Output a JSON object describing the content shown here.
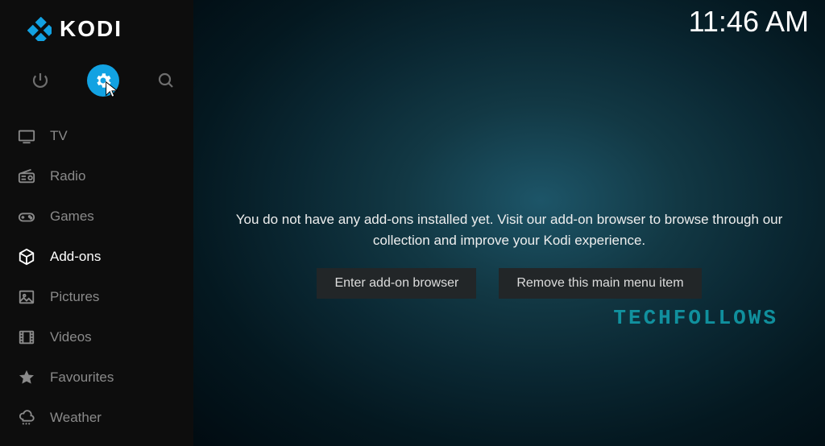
{
  "app": {
    "name": "KODI"
  },
  "clock": "11:46 AM",
  "sidebar": {
    "items": [
      {
        "label": "TV",
        "icon": "tv-icon",
        "selected": false
      },
      {
        "label": "Radio",
        "icon": "radio-icon",
        "selected": false
      },
      {
        "label": "Games",
        "icon": "gamepad-icon",
        "selected": false
      },
      {
        "label": "Add-ons",
        "icon": "box-icon",
        "selected": true
      },
      {
        "label": "Pictures",
        "icon": "picture-icon",
        "selected": false
      },
      {
        "label": "Videos",
        "icon": "film-icon",
        "selected": false
      },
      {
        "label": "Favourites",
        "icon": "star-icon",
        "selected": false
      },
      {
        "label": "Weather",
        "icon": "weather-icon",
        "selected": false
      }
    ]
  },
  "main": {
    "empty_message": "You do not have any add-ons installed yet. Visit our add-on browser to browse through our collection and improve your Kodi experience.",
    "buttons": {
      "enter_browser": "Enter add-on browser",
      "remove_item": "Remove this main menu item"
    }
  },
  "watermark": "TECHFOLLOWS",
  "colors": {
    "accent": "#12a2e2"
  }
}
